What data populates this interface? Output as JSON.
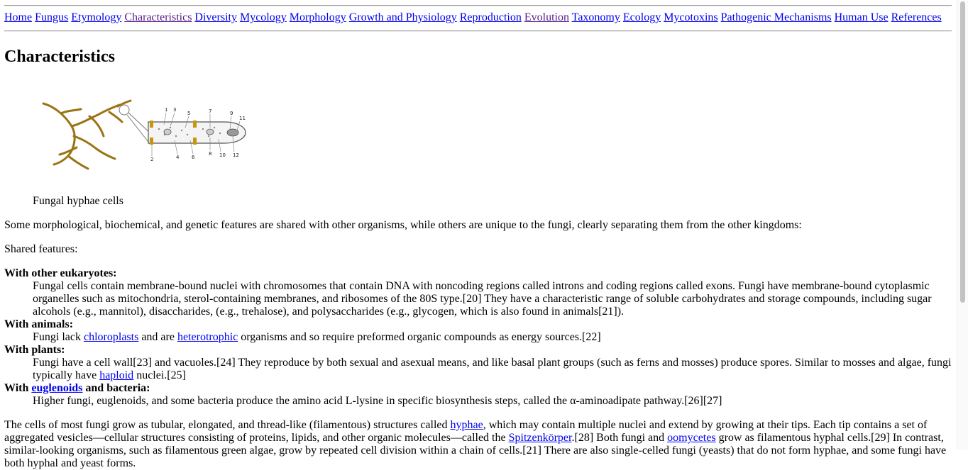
{
  "nav": {
    "links": [
      {
        "label": "Home",
        "visited": false
      },
      {
        "label": "Fungus",
        "visited": false
      },
      {
        "label": "Etymology",
        "visited": false
      },
      {
        "label": "Characteristics",
        "visited": true
      },
      {
        "label": "Diversity",
        "visited": false
      },
      {
        "label": "Mycology",
        "visited": false
      },
      {
        "label": "Morphology",
        "visited": false
      },
      {
        "label": "Growth and Physiology",
        "visited": false
      },
      {
        "label": "Reproduction",
        "visited": false
      },
      {
        "label": "Evolution",
        "visited": true
      },
      {
        "label": "Taxonomy",
        "visited": false
      },
      {
        "label": "Ecology",
        "visited": false
      },
      {
        "label": "Mycotoxins",
        "visited": false
      },
      {
        "label": "Pathogenic Mechanisms",
        "visited": false
      },
      {
        "label": "Human Use",
        "visited": false
      },
      {
        "label": "References",
        "visited": false
      }
    ]
  },
  "heading": "Characteristics",
  "figure": {
    "caption": "Fungal hyphae cells",
    "diagram_labels": [
      "1",
      "2",
      "3",
      "4",
      "5",
      "6",
      "7",
      "8",
      "9",
      "10",
      "11",
      "12"
    ],
    "colors": {
      "hyphae": "#9a7414",
      "septum": "#c8960a",
      "outline": "#555555"
    }
  },
  "intro": "Some morphological, biochemical, and genetic features are shared with other organisms, while others are unique to the fungi, clearly separating them from the other kingdoms:",
  "shared_label": "Shared features:",
  "features": {
    "eukaryotes": {
      "term": "With other eukaryotes:",
      "text": "Fungal cells contain membrane-bound nuclei with chromosomes that contain DNA with noncoding regions called introns and coding regions called exons. Fungi have membrane-bound cytoplasmic organelles such as mitochondria, sterol-containing membranes, and ribosomes of the 80S type.[20] They have a characteristic range of soluble carbohydrates and storage compounds, including sugar alcohols (e.g., mannitol), disaccharides, (e.g., trehalose), and polysaccharides (e.g., glycogen, which is also found in animals[21])."
    },
    "animals": {
      "term": "With animals:",
      "pre": "Fungi lack ",
      "link1": "chloroplasts",
      "mid": " and are ",
      "link2": "heterotrophic",
      "post": " organisms and so require preformed organic compounds as energy sources.[22]"
    },
    "plants": {
      "term": "With plants:",
      "pre": "Fungi have a cell wall[23] and vacuoles.[24] They reproduce by both sexual and asexual means, and like basal plant groups (such as ferns and mosses) produce spores. Similar to mosses and algae, fungi typically have ",
      "link": "haploid",
      "post": " nuclei.[25]"
    },
    "bacteria": {
      "term_pre": "With ",
      "term_link": "euglenoids",
      "term_post": " and bacteria:",
      "text": "Higher fungi, euglenoids, and some bacteria produce the amino acid L-lysine in specific biosynthesis steps, called the α-aminoadipate pathway.[26][27]"
    }
  },
  "growth": {
    "pre": "The cells of most fungi grow as tubular, elongated, and thread-like (filamentous) structures called ",
    "link1": "hyphae",
    "mid1": ", which may contain multiple nuclei and extend by growing at their tips. Each tip contains a set of aggregated vesicles—cellular structures consisting of proteins, lipids, and other organic molecules—called the ",
    "link2": "Spitzenkörper",
    "mid2": ".[28] Both fungi and ",
    "link3": "oomycetes",
    "post": " grow as filamentous hyphal cells.[29] In contrast, similar-looking organisms, such as filamentous green algae, grow by repeated cell division within a chain of cells.[21] There are also single-celled fungi (yeasts) that do not form hyphae, and some fungi have both hyphal and yeast forms."
  }
}
